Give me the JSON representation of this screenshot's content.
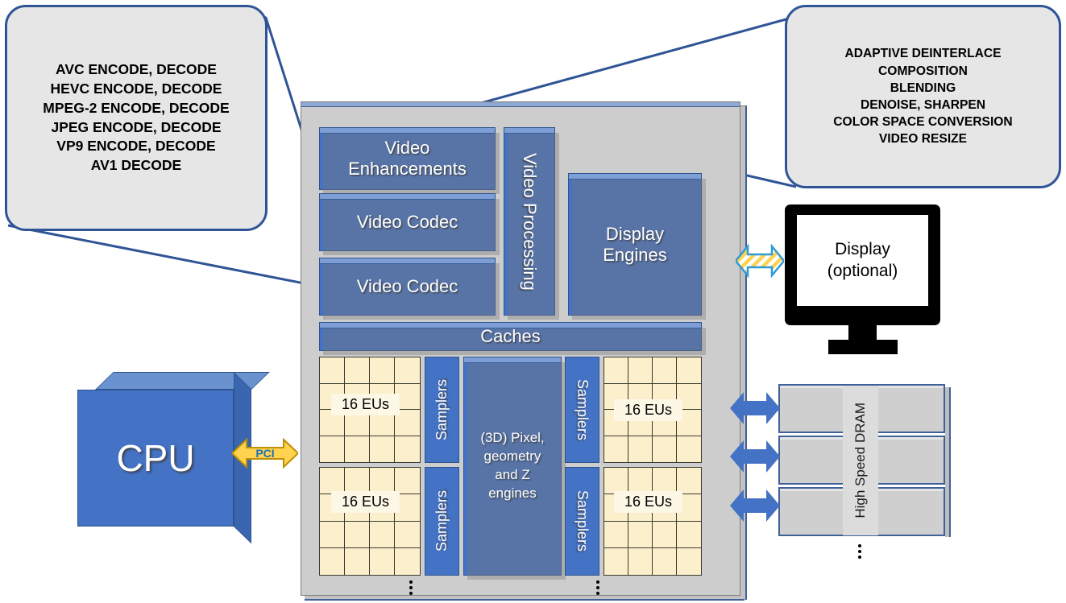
{
  "diagram": {
    "title": "GPU architecture block diagram"
  },
  "callouts": {
    "codec": {
      "name": "video-codec-capabilities",
      "lines": [
        "AVC ENCODE, DECODE",
        "HEVC ENCODE, DECODE",
        "MPEG-2 ENCODE, DECODE",
        "JPEG ENCODE, DECODE",
        "VP9 ENCODE, DECODE",
        "AV1 DECODE"
      ]
    },
    "video_processing": {
      "name": "video-processing-capabilities",
      "lines": [
        "ADAPTIVE DEINTERLACE",
        "COMPOSITION",
        "BLENDING",
        "DENOISE, SHARPEN",
        "COLOR SPACE CONVERSION",
        "VIDEO RESIZE"
      ]
    }
  },
  "die": {
    "blocks": {
      "video_enhancements": "Video\nEnhancements",
      "video_enhancements_l1": "Video",
      "video_enhancements_l2": "Enhancements",
      "video_codec_1": "Video Codec",
      "video_codec_2": "Video Codec",
      "video_processing": "Video Processing",
      "display_engines_l1": "Display",
      "display_engines_l2": "Engines",
      "caches": "Caches",
      "engines_3d_l1": "(3D) Pixel,",
      "engines_3d_l2": "geometry",
      "engines_3d_l3": "and Z",
      "engines_3d_l4": "engines"
    },
    "samplers": {
      "left_top": "Samplers",
      "left_bottom": "Samplers",
      "right_top": "Samplers",
      "right_bottom": "Samplers"
    },
    "eu_blocks": [
      {
        "id": "eu-top-left",
        "label": "16 EUs"
      },
      {
        "id": "eu-bottom-left",
        "label": "16 EUs"
      },
      {
        "id": "eu-top-right",
        "label": "16 EUs"
      },
      {
        "id": "eu-bottom-right",
        "label": "16 EUs"
      }
    ],
    "continuation_marker": "⋮"
  },
  "cpu": {
    "label": "CPU"
  },
  "interconnects": {
    "pci": {
      "label": "PCI",
      "color": "#FFD34F",
      "outline": "#BF9000"
    },
    "display_link": {
      "color": "#FFD34F",
      "outline": "#2E9BD6",
      "style": "striped"
    },
    "memory_links_color": "#4472C4",
    "memory_link_count": 3
  },
  "display": {
    "line1": "Display",
    "line2": "(optional)"
  },
  "dram": {
    "label": "High Speed DRAM",
    "slab_count": 3,
    "continuation_marker": "⋮"
  },
  "colors": {
    "block_blue": "#4472C4",
    "block_blue_light": "#7E9FD6",
    "die_gray": "#CDCDCD",
    "callout_fill": "#E7E6E6",
    "callout_border": "#2F5496",
    "eu_cream": "#FCEFCB",
    "eu_gridline": "#3B3B30",
    "dram_gray": "#CFCFCF"
  }
}
